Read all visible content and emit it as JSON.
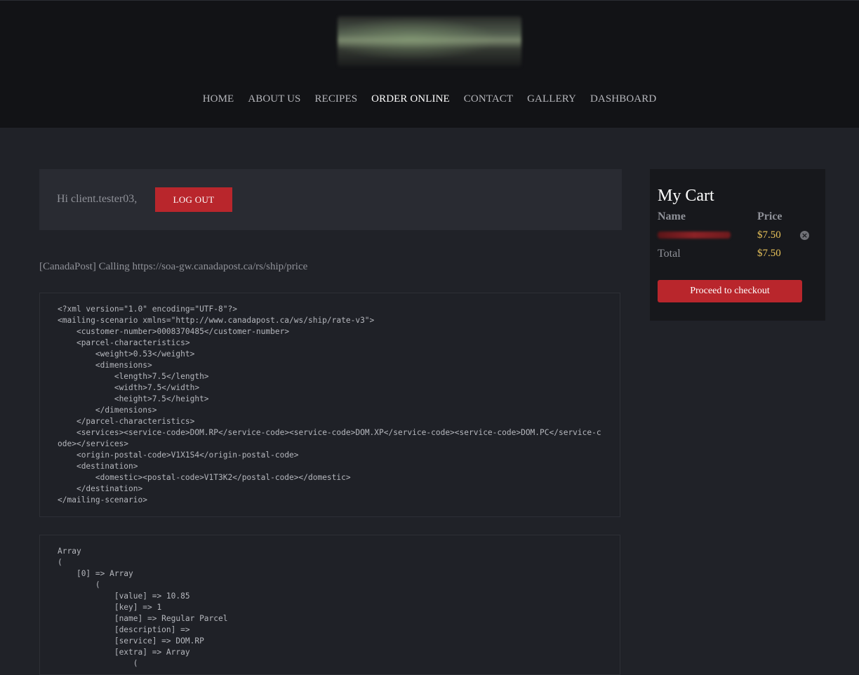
{
  "nav": {
    "items": [
      "HOME",
      "ABOUT US",
      "RECIPES",
      "ORDER ONLINE",
      "CONTACT",
      "GALLERY",
      "DASHBOARD"
    ],
    "active": "ORDER ONLINE"
  },
  "welcome": {
    "greeting": "Hi client.tester03,",
    "logout_label": "LOG OUT"
  },
  "log": {
    "calling_text": "[CanadaPost] Calling https://soa-gw.canadapost.ca/rs/ship/price",
    "xml_request": "<?xml version=\"1.0\" encoding=\"UTF-8\"?>\n<mailing-scenario xmlns=\"http://www.canadapost.ca/ws/ship/rate-v3\">\n    <customer-number>0008370485</customer-number>\n    <parcel-characteristics>\n        <weight>0.53</weight>\n        <dimensions>\n            <length>7.5</length>\n            <width>7.5</width>\n            <height>7.5</height>\n        </dimensions>\n    </parcel-characteristics>\n    <services><service-code>DOM.RP</service-code><service-code>DOM.XP</service-code><service-code>DOM.PC</service-code></services>\n    <origin-postal-code>V1X1S4</origin-postal-code>\n    <destination>\n        <domestic><postal-code>V1T3K2</postal-code></domestic>\n    </destination>\n</mailing-scenario>",
    "array_dump": "Array\n(\n    [0] => Array\n        (\n            [value] => 10.85\n            [key] => 1\n            [name] => Regular Parcel\n            [description] => \n            [service] => DOM.RP\n            [extra] => Array\n                ("
  },
  "cart": {
    "title": "My Cart",
    "col_name": "Name",
    "col_price": "Price",
    "item_price": "$7.50",
    "total_label": "Total",
    "total_value": "$7.50",
    "checkout_label": "Proceed to checkout",
    "remove_icon": "close-circle-icon"
  },
  "colors": {
    "accent_red": "#b9262c",
    "price_gold": "#e8c25a",
    "header_bg": "#121316",
    "page_bg": "#202228"
  }
}
